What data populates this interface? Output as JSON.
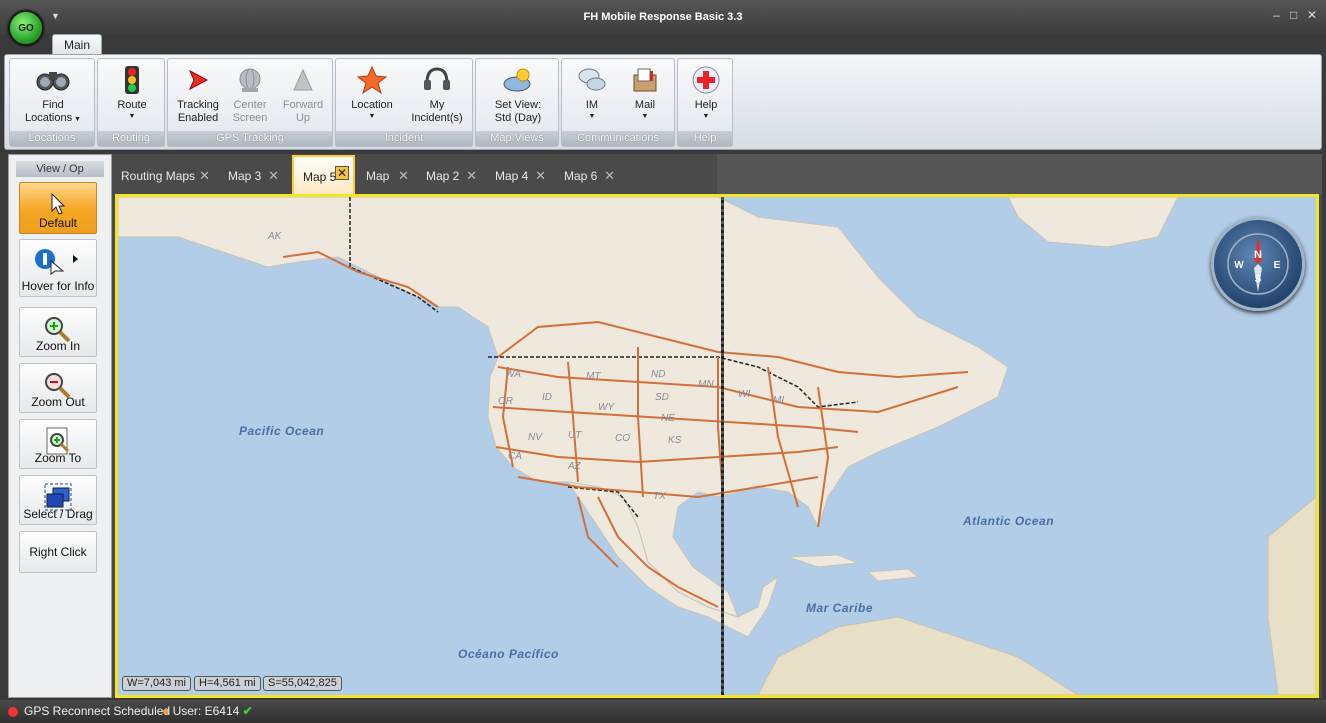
{
  "app": {
    "title": "FH Mobile Response Basic 3.3",
    "go_label": "GO"
  },
  "ribbon": {
    "tab": "Main",
    "groups": [
      {
        "label": "Locations",
        "buttons": [
          {
            "label1": "Find",
            "label2": "Locations",
            "icon": "binoculars-icon"
          }
        ]
      },
      {
        "label": "Routing",
        "buttons": [
          {
            "label1": "Route",
            "label2": "",
            "icon": "traffic-light-icon"
          }
        ]
      },
      {
        "label": "GPS Tracking",
        "buttons": [
          {
            "label1": "Tracking",
            "label2": "Enabled",
            "icon": "arrow-icon"
          },
          {
            "label1": "Center",
            "label2": "Screen",
            "icon": "globe-icon"
          },
          {
            "label1": "Forward",
            "label2": "Up",
            "icon": "cone-icon"
          }
        ]
      },
      {
        "label": "Incident",
        "buttons": [
          {
            "label1": "Location",
            "label2": "",
            "icon": "star-icon"
          },
          {
            "label1": "My",
            "label2": "Incident(s)",
            "icon": "headset-icon"
          }
        ]
      },
      {
        "label": "Map Views",
        "buttons": [
          {
            "label1": "Set View:",
            "label2": "Std (Day)",
            "icon": "map-view-icon"
          }
        ]
      },
      {
        "label": "Communications",
        "buttons": [
          {
            "label1": "IM",
            "label2": "",
            "icon": "chat-icon"
          },
          {
            "label1": "Mail",
            "label2": "",
            "icon": "mailbox-icon"
          }
        ]
      },
      {
        "label": "Help",
        "buttons": [
          {
            "label1": "Help",
            "label2": "",
            "icon": "help-cross-icon"
          }
        ]
      }
    ]
  },
  "toolpanel": {
    "header": "View / Op",
    "tools": [
      "Default",
      "Hover for Info",
      "Zoom In",
      "Zoom Out",
      "Zoom To",
      "Select / Drag",
      "Right Click"
    ]
  },
  "map_tabs": [
    "Routing Maps",
    "Map 3",
    "Map 5",
    "Map",
    "Map 2",
    "Map 4",
    "Map 6"
  ],
  "active_map_tab": "Map 5",
  "map": {
    "oceans": {
      "pacific": "Pacific Ocean",
      "atlantic": "Atlantic Ocean",
      "caribe": "Mar Caribe",
      "oceano_pacifico": "Océano Pacífico"
    },
    "states": [
      "AK",
      "WA",
      "OR",
      "ID",
      "MT",
      "ND",
      "MN",
      "SD",
      "WY",
      "NE",
      "NV",
      "UT",
      "CO",
      "KS",
      "CA",
      "AZ",
      "TX",
      "WI",
      "MI"
    ],
    "scale": {
      "width": "W=7,043 mi",
      "height": "H=4,561 mi",
      "scale": "S=55,042,825"
    },
    "compass": {
      "n": "N",
      "s": "S",
      "e": "E",
      "w": "W"
    }
  },
  "status": {
    "gps": "GPS Reconnect Scheduled",
    "user": "User: E6414"
  },
  "colors": {
    "accent": "#f5a623",
    "map_frame": "#f2e626",
    "routes": "#d2703a",
    "water": "#b2cde8",
    "land": "#efe9dd"
  }
}
